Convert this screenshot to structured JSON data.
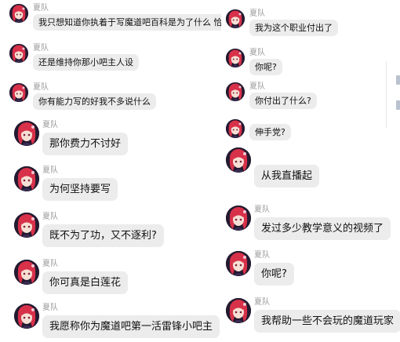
{
  "colors": {
    "bubble": "#ececec",
    "name_text": "#9a9a9a",
    "message_text": "#111111",
    "avatar_hair": "#d8314a"
  },
  "icons": {
    "avatar": "anime-girl-avatar-icon"
  },
  "panels": {
    "top_left": {
      "messages": [
        {
          "sender": "夏队",
          "text": "我只想知道你执着于写魔道吧百科是为了什么 恰米?"
        },
        {
          "sender": "夏队",
          "text": "还是维持你那小吧主人设"
        },
        {
          "sender": "夏队",
          "text": "你有能力写的好我不多说什么"
        }
      ]
    },
    "bottom_left": {
      "messages": [
        {
          "sender": "夏队",
          "text": "那你费力不讨好"
        },
        {
          "sender": "夏队",
          "text": "为何坚持要写"
        },
        {
          "sender": "夏队",
          "text": "既不为了功，又不逐利?"
        },
        {
          "sender": "夏队",
          "text": "你可真是白莲花"
        },
        {
          "sender": "夏队",
          "text": "我愿称你为魔道吧第一活雷锋小吧主"
        }
      ]
    },
    "top_right": {
      "messages": [
        {
          "sender": "夏队",
          "text": "我为这个职业付出了"
        },
        {
          "sender": "夏队",
          "text": "你呢?"
        },
        {
          "sender": "夏队",
          "text": "你付出了什么?"
        },
        {
          "sender": "",
          "text": "伸手党?"
        }
      ]
    },
    "bottom_right": {
      "messages": [
        {
          "sender": "",
          "text": "从我直播起"
        },
        {
          "sender": "夏队",
          "text": "发过多少教学意义的视频了"
        },
        {
          "sender": "夏队",
          "text": "你呢?"
        },
        {
          "sender": "夏队",
          "text": "我帮助一些不会玩的魔道玩家"
        }
      ]
    }
  }
}
